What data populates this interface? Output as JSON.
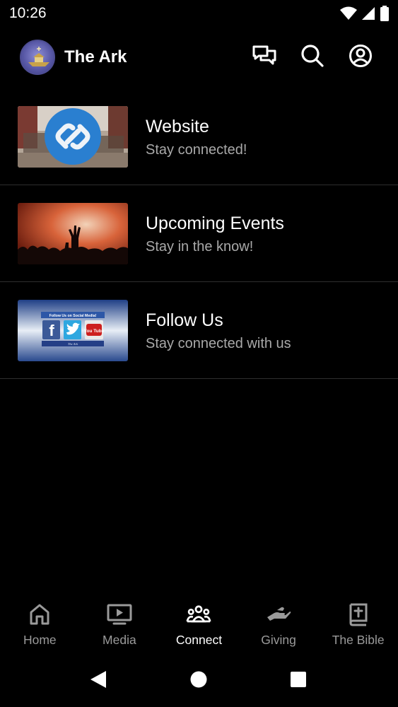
{
  "status_bar": {
    "time": "10:26",
    "icons": [
      "wifi-icon",
      "signal-icon",
      "battery-icon"
    ]
  },
  "header": {
    "title": "The Ark",
    "logo": "church-logo",
    "actions": [
      "chat-icon",
      "search-icon",
      "account-icon"
    ]
  },
  "items": [
    {
      "title": "Website",
      "subtitle": "Stay connected!",
      "thumbnail": "link-chain-image"
    },
    {
      "title": "Upcoming Events",
      "subtitle": "Stay in the know!",
      "thumbnail": "worship-crowd-image"
    },
    {
      "title": "Follow Us",
      "subtitle": "Stay connected with us",
      "thumbnail": "social-media-banner",
      "banner": {
        "heading": "Follow Us on Social Media!",
        "logos": [
          "f",
          "",
          "You Tube"
        ],
        "footer": "The Ark"
      }
    }
  ],
  "bottom_nav": [
    {
      "label": "Home",
      "icon": "home-icon",
      "active": false
    },
    {
      "label": "Media",
      "icon": "media-play-icon",
      "active": false
    },
    {
      "label": "Connect",
      "icon": "people-group-icon",
      "active": true
    },
    {
      "label": "Giving",
      "icon": "hand-giving-icon",
      "active": false
    },
    {
      "label": "The Bible",
      "icon": "bible-icon",
      "active": false
    }
  ],
  "system_nav": [
    "back-icon",
    "home-circle-icon",
    "recents-icon"
  ],
  "colors": {
    "background": "#000000",
    "subtitle_text": "#a9a9a9",
    "inactive_nav": "#9a9a9a",
    "divider": "#2e2e2e"
  }
}
